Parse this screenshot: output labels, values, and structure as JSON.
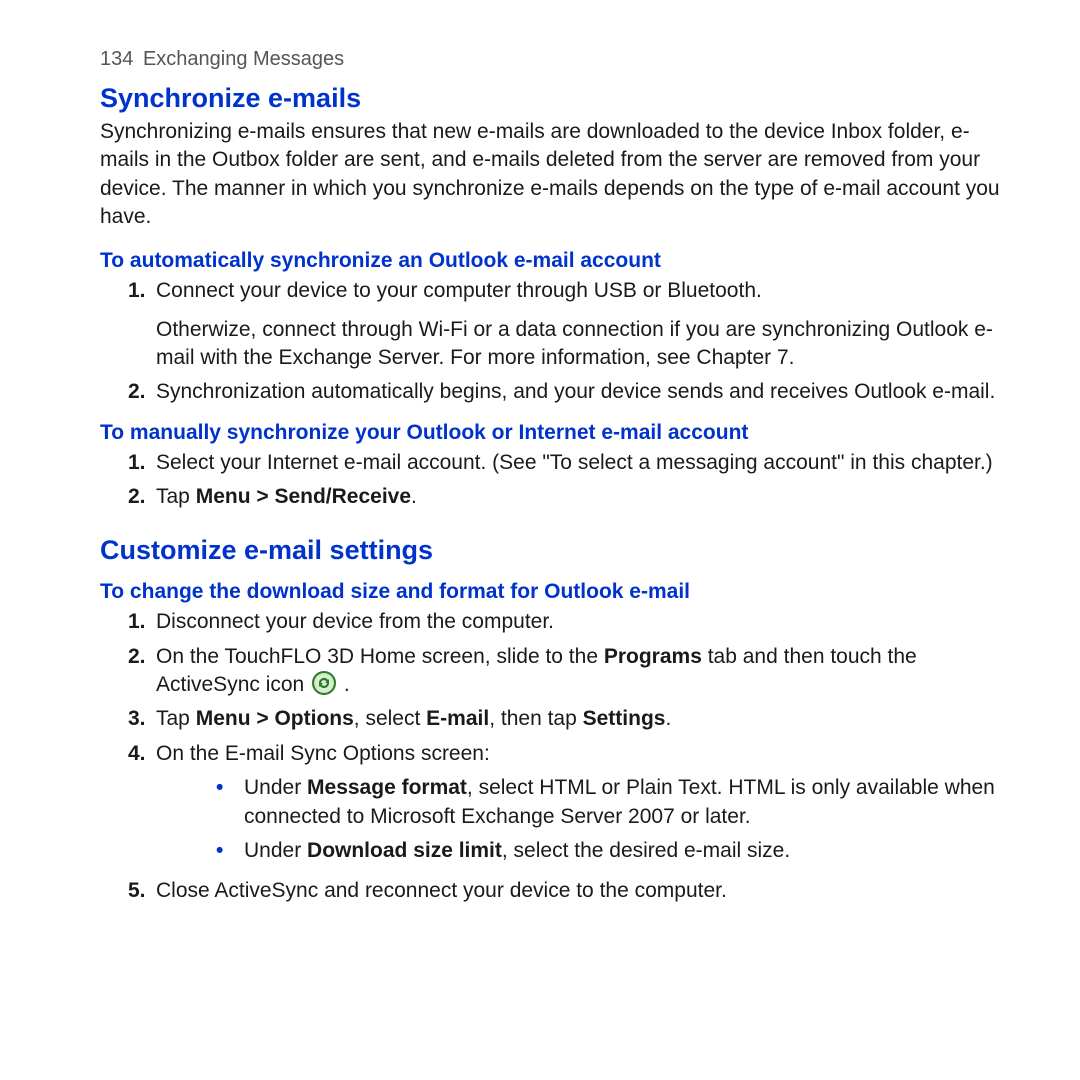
{
  "header": {
    "page_number": "134",
    "chapter": "Exchanging Messages"
  },
  "sections": [
    {
      "title": "Synchronize e-mails",
      "intro": "Synchronizing e-mails ensures that new e-mails are downloaded to the device Inbox folder, e-mails in the Outbox folder are sent, and e-mails deleted from the server are removed from your device. The manner in which you synchronize e-mails depends on the type of e-mail account you have.",
      "subsections": [
        {
          "title": "To automatically synchronize an Outlook e-mail account",
          "steps": [
            {
              "num": "1.",
              "text": "Connect your device to your computer through USB or Bluetooth.",
              "extra": "Otherwize, connect through Wi-Fi or a data connection if you are synchronizing Outlook e-mail with the Exchange Server. For more information, see Chapter 7."
            },
            {
              "num": "2.",
              "text": "Synchronization automatically begins, and your device sends and receives Outlook e-mail."
            }
          ]
        },
        {
          "title": "To manually synchronize your Outlook or Internet e-mail account",
          "steps": [
            {
              "num": "1.",
              "text": "Select your Internet e-mail account. (See \"To select a messaging account\" in this chapter.)"
            },
            {
              "num": "2.",
              "bold_prefix": "Tap ",
              "bold": "Menu > Send/Receive",
              "bold_suffix": "."
            }
          ]
        }
      ]
    },
    {
      "title": "Customize e-mail settings",
      "subsections": [
        {
          "title": "To change the download size and format for Outlook e-mail",
          "steps": [
            {
              "num": "1.",
              "text": "Disconnect your device from the computer."
            },
            {
              "num": "2.",
              "pre": "On the TouchFLO 3D Home screen, slide to the ",
              "b1": "Programs",
              "mid": " tab and then touch the ActiveSync icon ",
              "icon": "activesync-icon",
              "post": " ."
            },
            {
              "num": "3.",
              "pre": "Tap ",
              "b1": "Menu > Options",
              "mid": ", select ",
              "b2": "E-mail",
              "mid2": ", then tap ",
              "b3": "Settings",
              "post": "."
            },
            {
              "num": "4.",
              "text": "On the E-mail Sync Options screen:",
              "bullets": [
                {
                  "pre": "Under ",
                  "b1": "Message format",
                  "post": ", select HTML or Plain Text. HTML is only available when connected to Microsoft Exchange Server 2007 or later."
                },
                {
                  "pre": "Under ",
                  "b1": "Download size limit",
                  "post": ", select the desired e-mail size."
                }
              ]
            },
            {
              "num": "5.",
              "text": "Close ActiveSync and reconnect your device to the computer."
            }
          ]
        }
      ]
    }
  ]
}
